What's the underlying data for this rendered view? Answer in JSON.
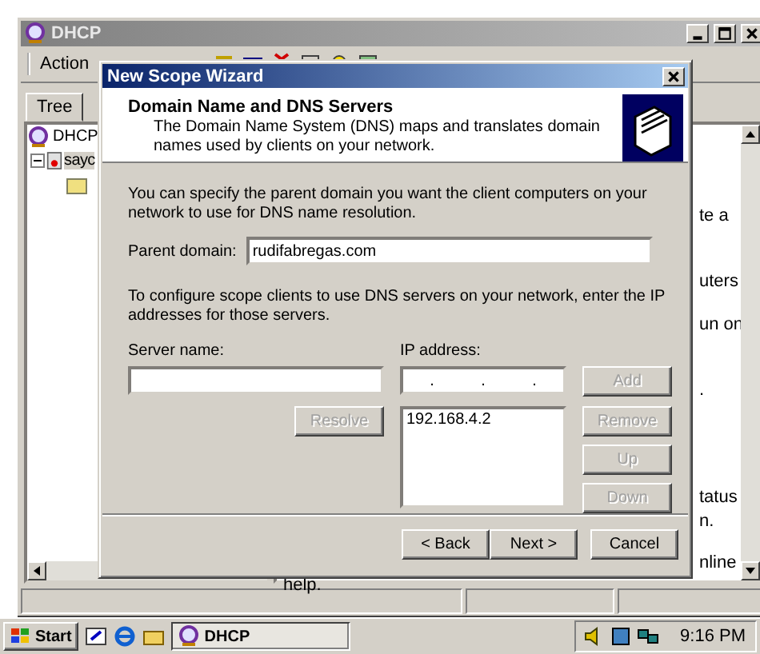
{
  "app_window": {
    "title": "DHCP",
    "menu": [
      "Action"
    ],
    "tree_tab": "Tree",
    "tree": [
      {
        "label": "DHCP",
        "children": [
          {
            "label": "sayc",
            "expanded": true
          }
        ]
      }
    ],
    "details_fragments": [
      "te a",
      "uters",
      "un on",
      ".",
      "tatus",
      "n.",
      "nline",
      "help."
    ]
  },
  "wizard": {
    "title": "New Scope Wizard",
    "heading": "Domain Name and DNS Servers",
    "subtitle": "The Domain Name System (DNS) maps and translates domain names used by clients on your network.",
    "intro": "You can specify the parent domain you want the client computers on your network to use for DNS name resolution.",
    "parent_domain": {
      "label": "Parent domain:",
      "value": "rudifabregas.com"
    },
    "dns_text": "To configure scope clients to use DNS servers on your network, enter the IP addresses for those servers.",
    "server_name": {
      "label": "Server name:"
    },
    "ip_address": {
      "label": "IP address:",
      "separators": [
        ".",
        ".",
        "."
      ]
    },
    "resolve": {
      "label": "Resolve",
      "disabled": true
    },
    "ip_list": [
      "192.168.4.2"
    ],
    "side_buttons": [
      {
        "label": "Add",
        "disabled": true
      },
      {
        "label": "Remove",
        "disabled": true
      },
      {
        "label": "Up",
        "disabled": true
      },
      {
        "label": "Down",
        "disabled": true
      }
    ],
    "footer_buttons": [
      {
        "label": "< Back",
        "disabled": false
      },
      {
        "label": "Next >",
        "disabled": false
      },
      {
        "label": "Cancel",
        "disabled": false
      }
    ]
  },
  "taskbar": {
    "start": "Start",
    "tasks": [
      "DHCP"
    ],
    "clock": "9:16 PM"
  }
}
